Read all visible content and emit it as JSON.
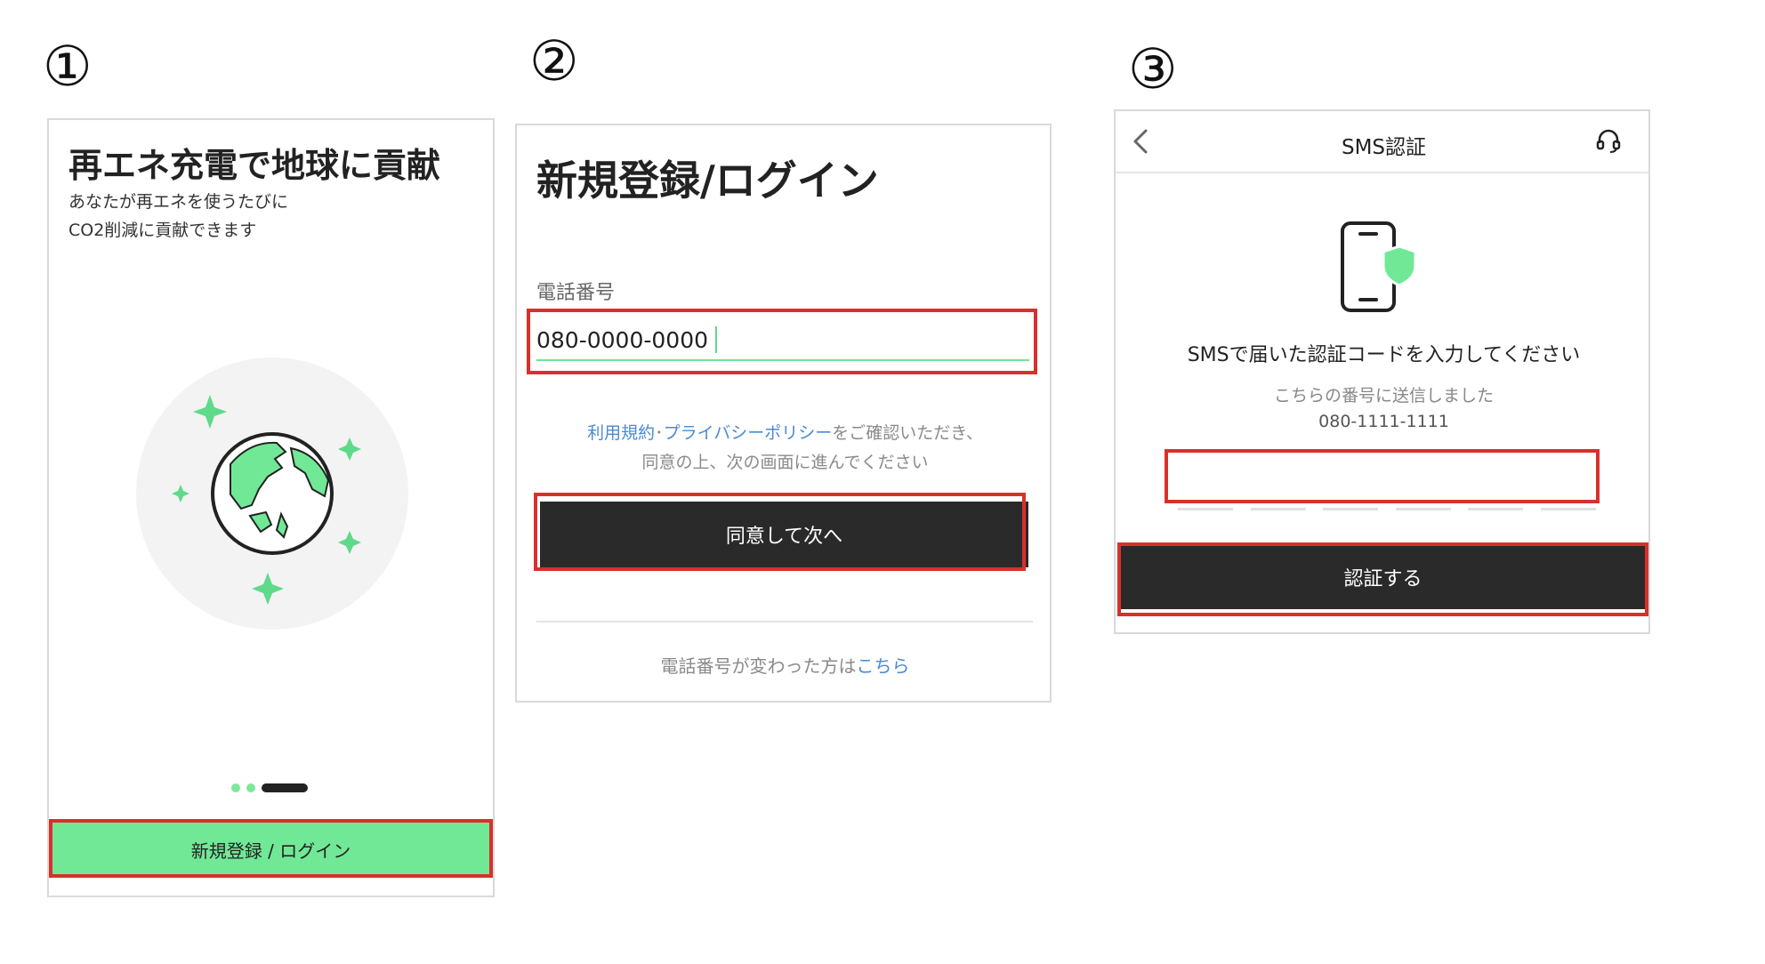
{
  "steps": [
    "①",
    "②",
    "③"
  ],
  "panel1": {
    "title": "再エネ充電で地球に貢献",
    "subtitle_line1": "あなたが再エネを使うたびに",
    "subtitle_line2": "CO2削減に貢献できます",
    "illustration_icon": "globe-with-sparkles-icon",
    "pagination": {
      "total": 3,
      "active": 3
    },
    "button_label": "新規登録 / ログイン"
  },
  "panel2": {
    "title": "新規登録/ログイン",
    "phone_label": "電話番号",
    "phone_value": "080-0000-0000",
    "terms_link1": "利用規約",
    "terms_separator": "･",
    "terms_link2": "プライバシーポリシー",
    "terms_text1": "をご確認いただき、",
    "terms_text2": "同意の上、次の画面に進んでください",
    "button_label": "同意して次へ",
    "changed_text": "電話番号が変わった方は",
    "changed_link": "こちら"
  },
  "panel3": {
    "back_icon": "chevron-left-icon",
    "header_title": "SMS認証",
    "support_icon": "headset-icon",
    "phone_icon": "phone-shield-icon",
    "message": "SMSで届いた認証コードを入力してください",
    "sent_text": "こちらの番号に送信しました",
    "phone_number": "080-1111-1111",
    "button_label": "認証する"
  },
  "colors": {
    "accent_green": "#71e896",
    "highlight_red": "#d9302c",
    "dark_button": "#2a2a2a",
    "link_blue": "#4a8ad4"
  }
}
